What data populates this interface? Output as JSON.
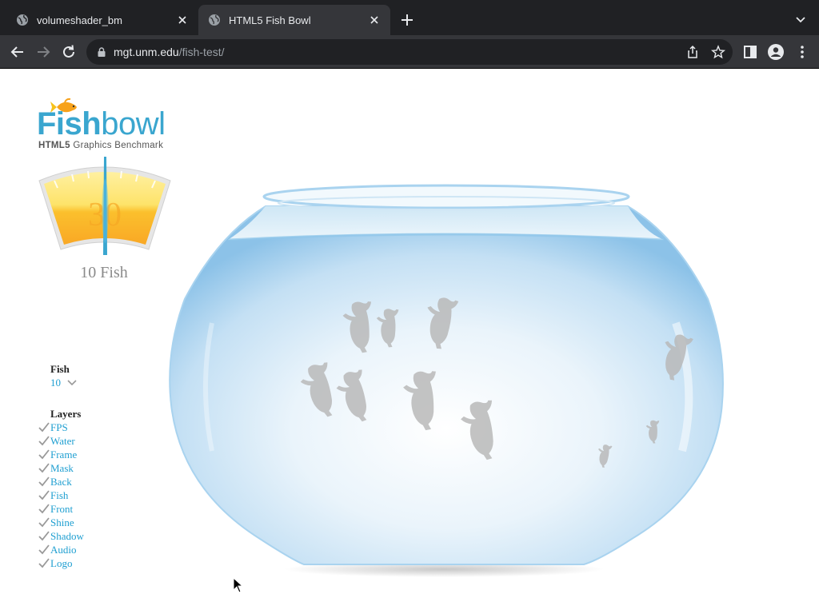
{
  "browser": {
    "tabs": [
      {
        "title": "volumeshader_bm",
        "active": false,
        "icon": "globe-icon"
      },
      {
        "title": "HTML5 Fish Bowl",
        "active": true,
        "icon": "globe-icon"
      }
    ],
    "url_host": "mgt.unm.edu",
    "url_path": "/fish-test/"
  },
  "page": {
    "logo": {
      "title_bold": "Fish",
      "title_light": "bowl",
      "subtitle_bold": "HTML5",
      "subtitle_rest": " Graphics Benchmark"
    },
    "gauge": {
      "fps": "30"
    },
    "fish_count_text": "10 Fish",
    "controls": {
      "fish_label": "Fish",
      "fish_value": "10",
      "layers_label": "Layers",
      "layers": [
        {
          "label": "FPS",
          "checked": true
        },
        {
          "label": "Water",
          "checked": true
        },
        {
          "label": "Frame",
          "checked": true
        },
        {
          "label": "Mask",
          "checked": true
        },
        {
          "label": "Back",
          "checked": true
        },
        {
          "label": "Fish",
          "checked": true
        },
        {
          "label": "Front",
          "checked": true
        },
        {
          "label": "Shine",
          "checked": true
        },
        {
          "label": "Shadow",
          "checked": true
        },
        {
          "label": "Audio",
          "checked": true
        },
        {
          "label": "Logo",
          "checked": true
        }
      ]
    }
  },
  "colors": {
    "chrome_dark": "#202124",
    "chrome_tab": "#35363a",
    "link_blue": "#1f9fd1",
    "logo_blue": "#3aa6cf",
    "gauge_yellow": "#fde36a",
    "gauge_orange": "#f9a825",
    "water_blue": "#a9d3ef"
  }
}
